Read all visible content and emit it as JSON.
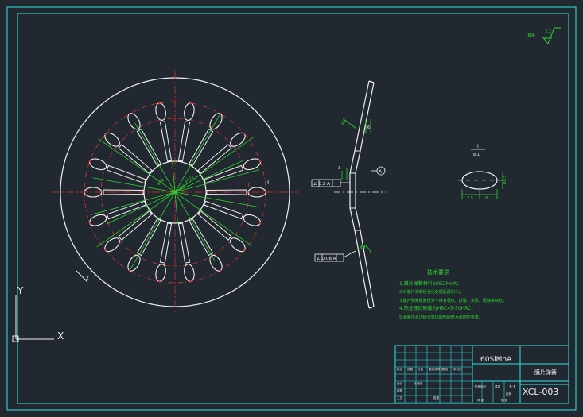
{
  "drawing": {
    "surface_roughness": "3.2",
    "roughness_label": "其余",
    "left_dims": [
      "φ80",
      "φ126",
      "φ172"
    ],
    "left_leader": "2",
    "side_dims": [
      "6",
      "45°",
      "3",
      "14°"
    ],
    "flatness_box": "∠ 0.2 A",
    "flatness_box_2": "∠ 0.08 A",
    "datum": "A",
    "section_title_top": "I",
    "section_title_bottom": "8:1",
    "section_dims": [
      "R0.5",
      "7.5",
      "8"
    ],
    "tech_req_title": "技术要求",
    "tech_reqs": [
      "1.膜片弹簧材料60Si2MnA；",
      "2.对膜片弹簧经强化处理后再加工；",
      "3.膜片弹簧碟簧部分不得有裂纹、折叠、夹层、锈蚀等缺陷；",
      "4.热处理后硬度为HRC45-50HRC；",
      "5.弹簧内孔边缘分离指端部硬度及耐磨性要求。"
    ]
  },
  "title_block": {
    "material": "60SiMnA",
    "part_name": "膜片弹簧",
    "drawing_no": "XCL-003",
    "scale": "1:1",
    "small_labels": [
      "标记",
      "处数",
      "分区",
      "更改文件号",
      "签名",
      "年月日",
      "设计",
      "标准化",
      "审核",
      "工艺",
      "批准",
      "阶段标记",
      "重量",
      "比例",
      "共 张",
      "第 张"
    ]
  },
  "ucs": {
    "y_label": "Y",
    "x_label": "X"
  },
  "colors": {
    "background": "#212830",
    "frame": "#2ee6e6",
    "part": "#f0f0f0",
    "center_line": "#e03030",
    "dimension": "#2cd42c"
  }
}
